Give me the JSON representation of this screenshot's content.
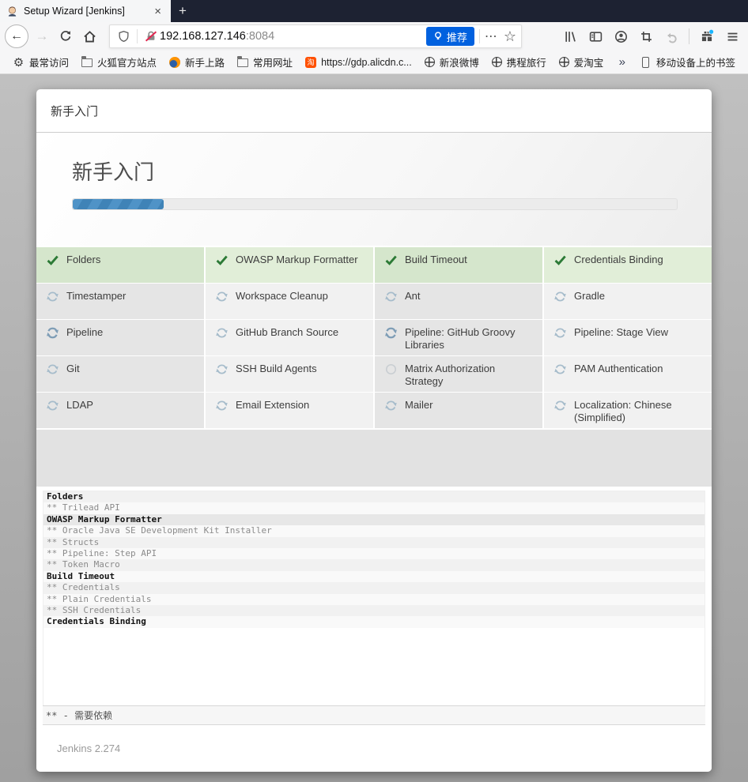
{
  "browser": {
    "tab_title": "Setup Wizard [Jenkins]",
    "tab_close": "×",
    "new_tab": "+",
    "url_host": "192.168.127.146",
    "url_port": ":8084",
    "recommend_label": "推荐",
    "bookmarks": [
      {
        "label": "最常访问",
        "icon": "gear"
      },
      {
        "label": "火狐官方站点",
        "icon": "folder"
      },
      {
        "label": "新手上路",
        "icon": "firefox"
      },
      {
        "label": "常用网址",
        "icon": "folder"
      },
      {
        "label": "https://gdp.alicdn.c...",
        "icon": "taobao"
      },
      {
        "label": "新浪微博",
        "icon": "globe"
      },
      {
        "label": "携程旅行",
        "icon": "globe"
      },
      {
        "label": "爱淘宝",
        "icon": "globe"
      }
    ],
    "bookmarks_overflow": "»",
    "mobile_bookmarks": "移动设备上的书签"
  },
  "icons": {
    "back": "←",
    "forward": "→",
    "more": "⋯",
    "star": "☆"
  },
  "colors": {
    "accent_blue": "#0161df",
    "progress_blue": "#4f93c7",
    "done_green": "#2c7a36",
    "green_row": "#d5e6cc",
    "tabbar_dark": "#1d2232"
  },
  "wizard": {
    "dialog_title": "新手入门",
    "heading": "新手入门",
    "progress_percent": 15,
    "plugins": [
      {
        "name": "Folders",
        "status": "done"
      },
      {
        "name": "OWASP Markup Formatter",
        "status": "done"
      },
      {
        "name": "Build Timeout",
        "status": "done"
      },
      {
        "name": "Credentials Binding",
        "status": "done"
      },
      {
        "name": "Timestamper",
        "status": "pending"
      },
      {
        "name": "Workspace Cleanup",
        "status": "pending"
      },
      {
        "name": "Ant",
        "status": "pending"
      },
      {
        "name": "Gradle",
        "status": "pending"
      },
      {
        "name": "Pipeline",
        "status": "installing"
      },
      {
        "name": "GitHub Branch Source",
        "status": "pending"
      },
      {
        "name": "Pipeline: GitHub Groovy Libraries",
        "status": "installing"
      },
      {
        "name": "Pipeline: Stage View",
        "status": "pending"
      },
      {
        "name": "Git",
        "status": "pending"
      },
      {
        "name": "SSH Build Agents",
        "status": "pending"
      },
      {
        "name": "Matrix Authorization Strategy",
        "status": "none"
      },
      {
        "name": "PAM Authentication",
        "status": "pending"
      },
      {
        "name": "LDAP",
        "status": "pending"
      },
      {
        "name": "Email Extension",
        "status": "pending"
      },
      {
        "name": "Mailer",
        "status": "pending"
      },
      {
        "name": "Localization: Chinese (Simplified)",
        "status": "pending"
      }
    ],
    "log": [
      {
        "text": "Folders",
        "style": "head"
      },
      {
        "text": "** Trilead API",
        "style": "dep"
      },
      {
        "text": "OWASP Markup Formatter",
        "style": "head active"
      },
      {
        "text": "** Oracle Java SE Development Kit Installer",
        "style": "dep"
      },
      {
        "text": "** Structs",
        "style": "dep"
      },
      {
        "text": "** Pipeline: Step API",
        "style": "dep"
      },
      {
        "text": "** Token Macro",
        "style": "dep"
      },
      {
        "text": "Build Timeout",
        "style": "head"
      },
      {
        "text": "** Credentials",
        "style": "dep"
      },
      {
        "text": "** Plain Credentials",
        "style": "dep"
      },
      {
        "text": "** SSH Credentials",
        "style": "dep"
      },
      {
        "text": "Credentials Binding",
        "style": "head"
      }
    ],
    "deps_note": "** - 需要依赖",
    "version": "Jenkins 2.274"
  }
}
